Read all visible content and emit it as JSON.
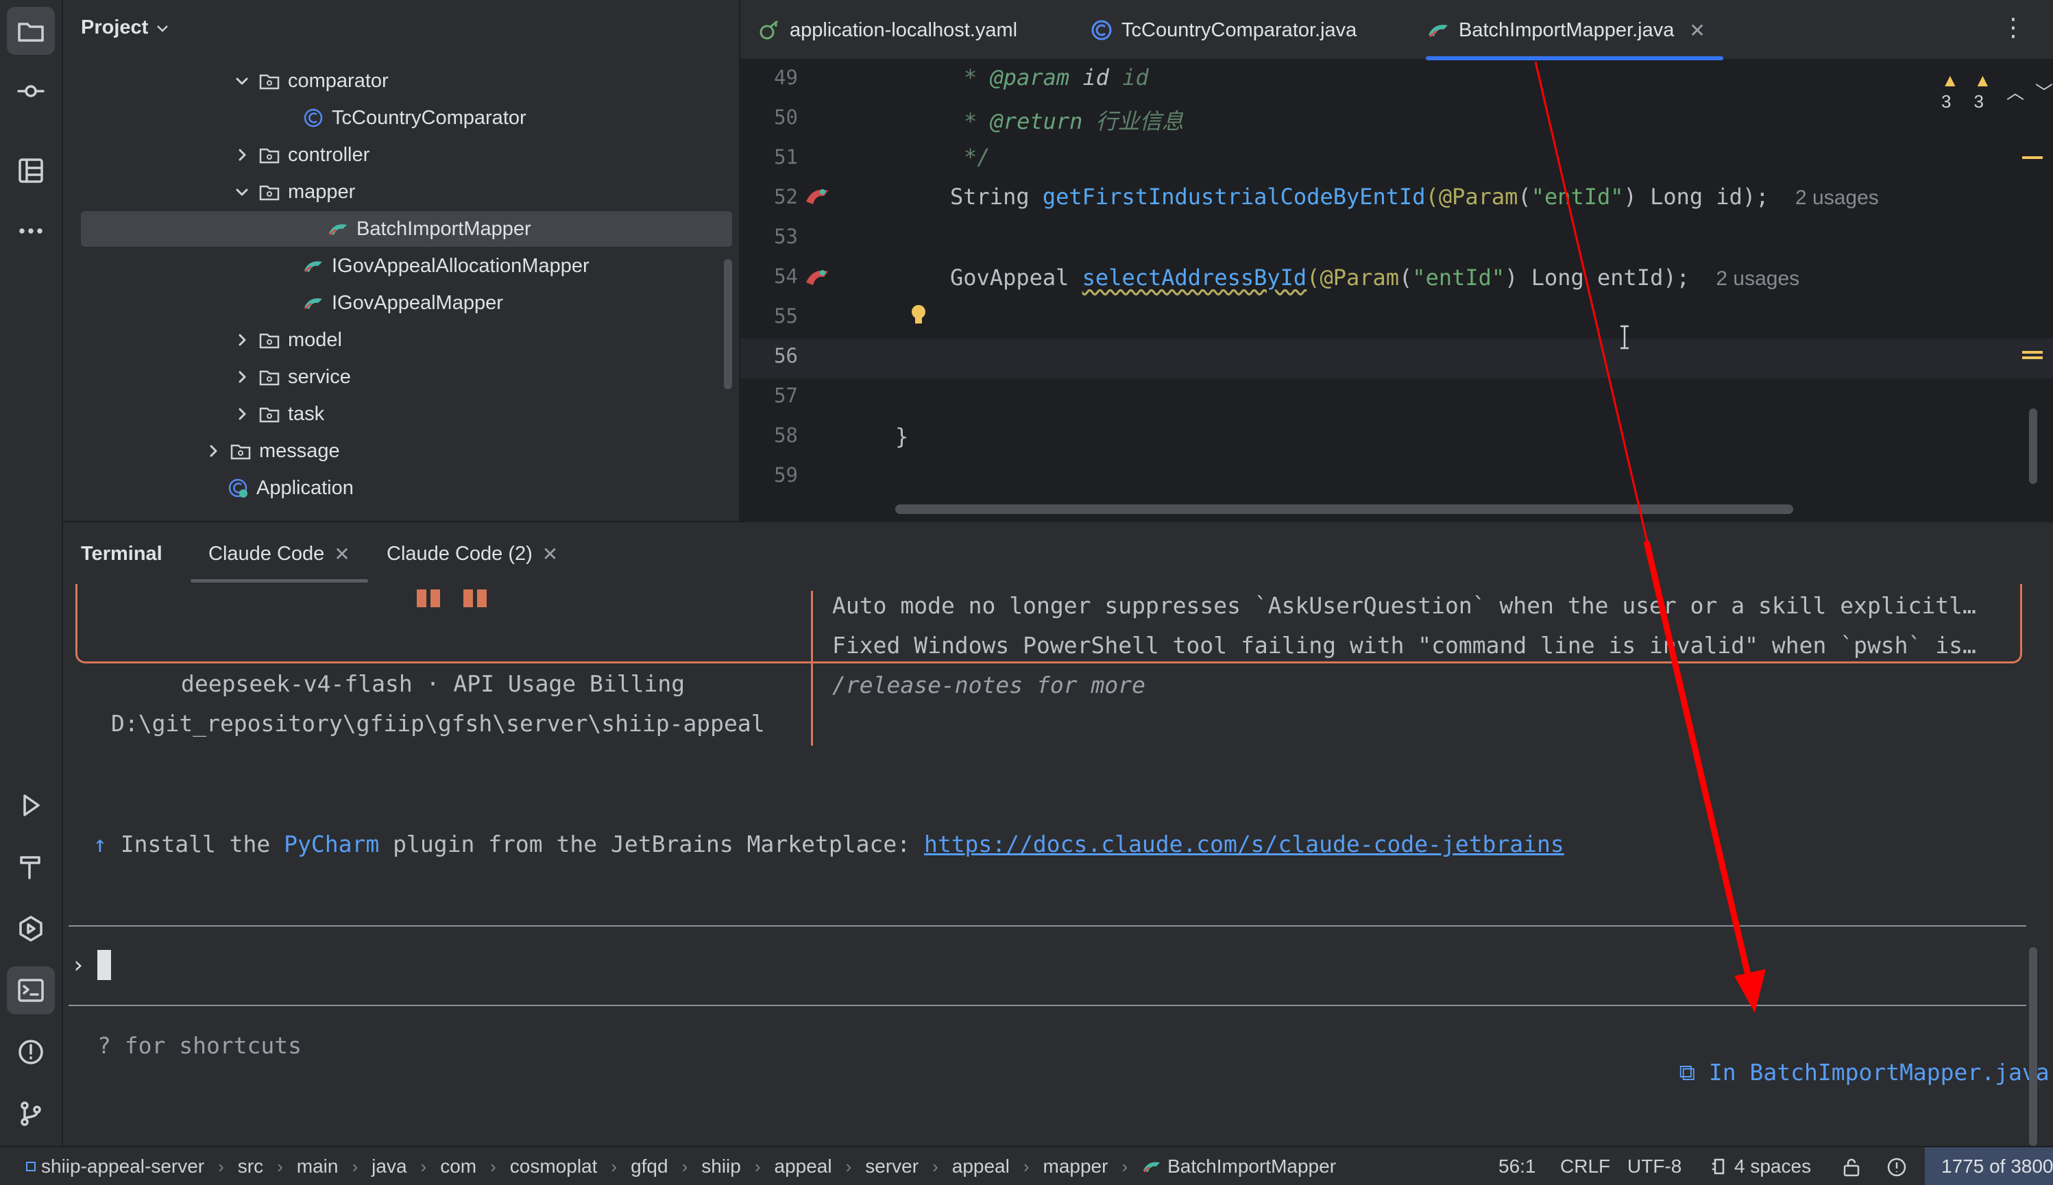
{
  "project_panel": {
    "title": "Project",
    "tree": [
      {
        "label": "comparator",
        "kind": "package",
        "expanded": true
      },
      {
        "label": "TcCountryComparator",
        "kind": "class"
      },
      {
        "label": "controller",
        "kind": "package",
        "expanded": false
      },
      {
        "label": "mapper",
        "kind": "package",
        "expanded": true
      },
      {
        "label": "BatchImportMapper",
        "kind": "mapper",
        "selected": true
      },
      {
        "label": "IGovAppealAllocationMapper",
        "kind": "mapper"
      },
      {
        "label": "IGovAppealMapper",
        "kind": "mapper"
      },
      {
        "label": "model",
        "kind": "package",
        "expanded": false
      },
      {
        "label": "service",
        "kind": "package",
        "expanded": false
      },
      {
        "label": "task",
        "kind": "package",
        "expanded": false
      },
      {
        "label": "message",
        "kind": "package",
        "expanded": false
      },
      {
        "label": "Application",
        "kind": "app-class"
      }
    ]
  },
  "editor_tabs": [
    {
      "label": "application-localhost.yaml",
      "icon": "yaml-icon"
    },
    {
      "label": "TcCountryComparator.java",
      "icon": "class-icon"
    },
    {
      "label": "BatchImportMapper.java",
      "icon": "mapper-icon",
      "active": true,
      "close": "✕"
    }
  ],
  "editor": {
    "inspections": {
      "warnings_a": "3",
      "warnings_b": "3"
    },
    "line_numbers": [
      "49",
      "50",
      "51",
      "52",
      "53",
      "54",
      "55",
      "56",
      "57",
      "58",
      "59"
    ],
    "current_line": "56",
    "lines": {
      "l49_star": "* ",
      "l49_tag": "@param",
      "l49_name": " id ",
      "l49_desc": "id",
      "l50_star": "* ",
      "l50_tag": "@return",
      "l50_desc": " 行业信息",
      "l51": "*/",
      "l52_type": "String ",
      "l52_fn": "getFirstIndustrialCodeByEntId",
      "l52_open": "(",
      "l52_ann": "@Param",
      "l52_str": "\"entId\"",
      "l52_rest": ") Long id);",
      "l52_hint": "2 usages",
      "l54_type": "GovAppeal ",
      "l54_fn": "selectAddressById",
      "l54_open": "(",
      "l54_ann": "@Param",
      "l54_str": "\"entId\"",
      "l54_rest": ") Long entId);",
      "l54_hint": "2 usages",
      "l58": "}"
    }
  },
  "tool_window": {
    "tabs": [
      {
        "label": "Terminal",
        "bold": true
      },
      {
        "label": "Claude Code",
        "active": true,
        "close": "✕"
      },
      {
        "label": "Claude Code (2)",
        "close": "✕"
      }
    ]
  },
  "terminal": {
    "model_line": "deepseek-v4-flash · API Usage Billing",
    "path_line": "D:\\git_repository\\gfiip\\gfsh\\server\\shiip-appeal",
    "notes": [
      "Auto mode no longer suppresses `AskUserQuestion` when the user or a skill explicitl…",
      "Fixed Windows PowerShell tool failing with \"command line is invalid\" when `pwsh` is…",
      "/release-notes for more"
    ],
    "install_arrow": "↑",
    "install_prefix": " Install the ",
    "install_product": "PyCharm",
    "install_middle": " plugin from the JetBrains Marketplace: ",
    "install_link": "https://docs.claude.com/s/claude-code-jetbrains",
    "prompt_symbol": "›",
    "shortcuts_hint": "? for shortcuts",
    "context_file": "In BatchImportMapper.java"
  },
  "statusbar": {
    "breadcrumbs": [
      "shiip-appeal-server",
      "src",
      "main",
      "java",
      "com",
      "cosmoplat",
      "gfqd",
      "shiip",
      "appeal",
      "server",
      "appeal",
      "mapper",
      "BatchImportMapper"
    ],
    "caret": "56:1",
    "line_sep": "CRLF",
    "encoding": "UTF-8",
    "indent": "4 spaces",
    "memory": "1775 of 3800"
  },
  "colors": {
    "accent": "#3574f0",
    "claude_orange": "#d77757",
    "annotation_arrow": "#ff0000",
    "warning": "#f2c55c"
  }
}
